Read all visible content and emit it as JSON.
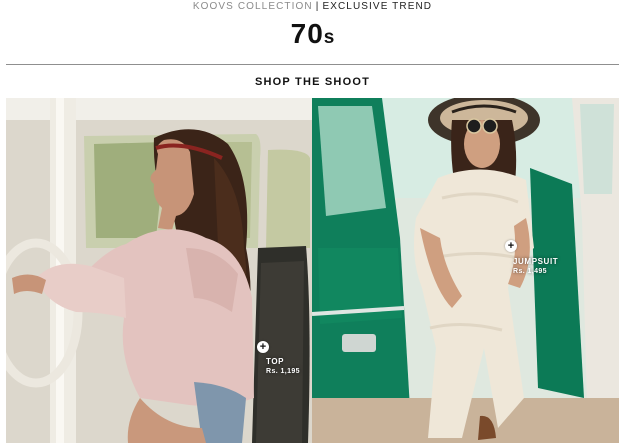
{
  "header": {
    "brand": "KOOVS COLLECTION",
    "separator": "|",
    "trend": "EXCLUSIVE TREND",
    "title_main": "70",
    "title_suffix": "s"
  },
  "section": {
    "title": "SHOP THE SHOOT"
  },
  "products": [
    {
      "name": "TOP",
      "price": "Rs. 1,195"
    },
    {
      "name": "JUMPSUIT",
      "price": "Rs. 1,495"
    }
  ],
  "colors": {
    "car_green": "#0f7f5b",
    "car_cream": "#ebe7df",
    "headband_red": "#8a2420",
    "blouse_pink": "#e3c3bf",
    "lace_white": "#efe7d8"
  },
  "icons": {
    "hotspot": "plus-icon"
  }
}
